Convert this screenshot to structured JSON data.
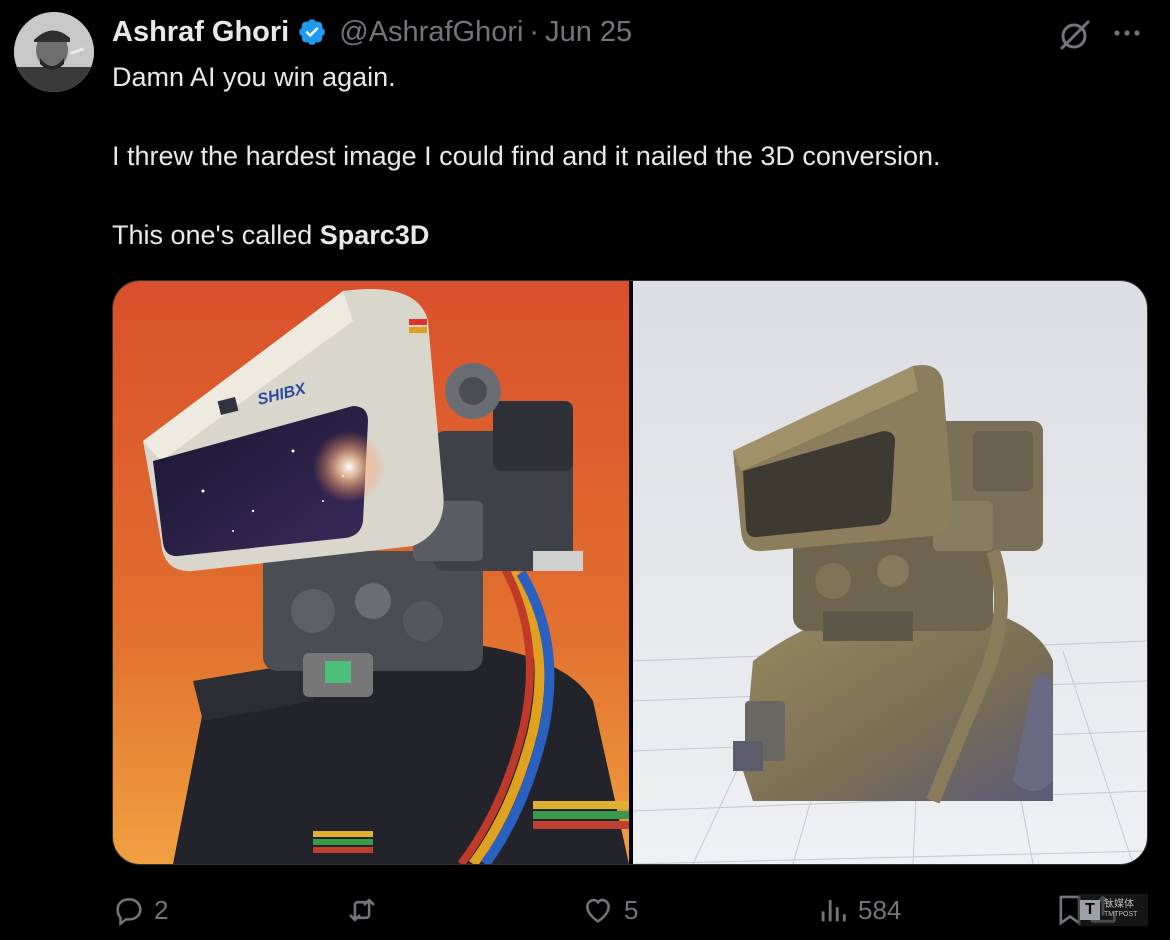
{
  "tweet": {
    "author_name": "Ashraf Ghori",
    "handle": "@AshrafGhori",
    "separator": "·",
    "date": "Jun 25",
    "line1": "Damn AI you win again.",
    "line2": "I threw the hardest image I could find and it nailed the 3D conversion.",
    "line3_prefix": "This one's called ",
    "line3_bold": "Sparc3D"
  },
  "media": {
    "left_image": "robot-astronaut-illustration",
    "left_visor_text": "SHIBX",
    "right_image": "3d-model-render"
  },
  "actions": {
    "replies": "2",
    "retweets": "",
    "likes": "5",
    "views": "584"
  },
  "watermark": {
    "top": "钛媒体",
    "bottom": "TMTPOST"
  },
  "colors": {
    "background": "#000000",
    "text": "#e7e9ea",
    "secondary": "#71767b",
    "verified": "#1d9bf0",
    "left_bg_top": "#d9502c",
    "left_bg_bottom": "#f0a040",
    "right_bg": "#e4e6eb",
    "model": "#8a7a5a"
  }
}
